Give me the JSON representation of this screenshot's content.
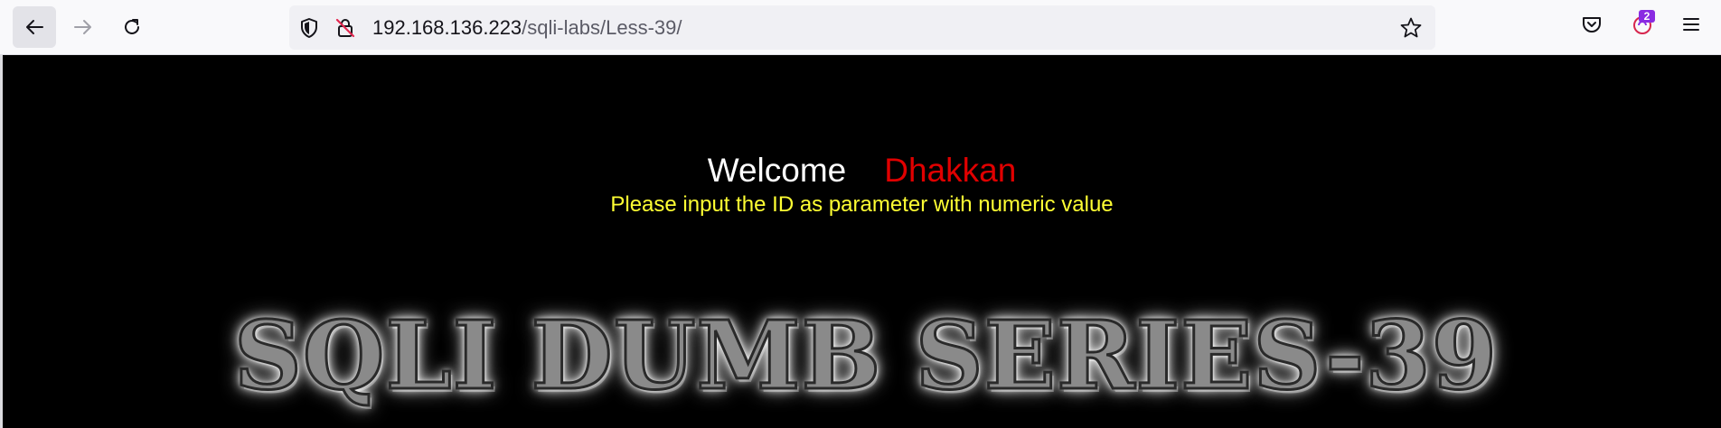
{
  "browser": {
    "url_host": "192.168.136.223",
    "url_path": "/sqli-labs/Less-39/",
    "notification_count": "2"
  },
  "page": {
    "welcome_label": "Welcome",
    "welcome_name": "Dhakkan",
    "instruction": "Please input the ID as parameter with numeric value",
    "banner_title": "SQLI DUMB SERIES-39"
  },
  "colors": {
    "background": "#000000",
    "welcome": "#ffffff",
    "name": "#e00000",
    "instruction": "#ffff33",
    "badge": "#8a2be2"
  },
  "icons": [
    "back-arrow-icon",
    "forward-arrow-icon",
    "reload-icon",
    "shield-icon",
    "insecure-lock-icon",
    "bookmark-star-icon",
    "pocket-icon",
    "firefox-account-icon",
    "hamburger-menu-icon"
  ]
}
